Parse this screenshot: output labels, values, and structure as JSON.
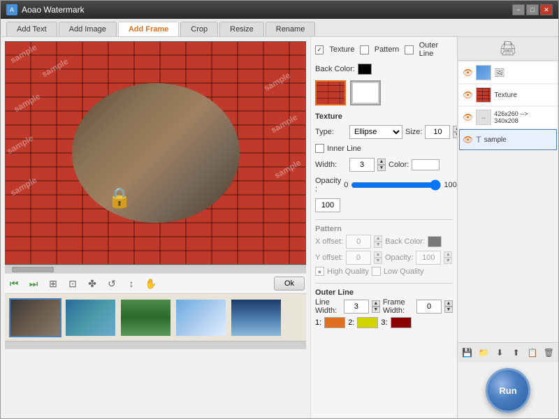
{
  "window": {
    "title": "Aoao Watermark",
    "icon": "A"
  },
  "title_controls": {
    "minimize": "−",
    "maximize": "□",
    "close": "✕"
  },
  "tabs": [
    {
      "label": "Add Text",
      "active": false
    },
    {
      "label": "Add Image",
      "active": false
    },
    {
      "label": "Add Frame",
      "active": true
    },
    {
      "label": "Crop",
      "active": false
    },
    {
      "label": "Resize",
      "active": false
    },
    {
      "label": "Rename",
      "active": false
    }
  ],
  "settings": {
    "texture_checked": true,
    "pattern_checked": false,
    "outer_line_checked": false,
    "back_color_label": "Back Color:",
    "texture_section_label": "Texture",
    "type_label": "Type:",
    "type_value": "Ellipse",
    "size_label": "Size:",
    "size_value": "10",
    "inner_line_checked": false,
    "inner_line_label": "Inner Line",
    "width_label": "Width:",
    "width_value": "3",
    "color_label": "Color:",
    "opacity_label": "Opacity :",
    "opacity_min": "0",
    "opacity_max": "100",
    "opacity_value": "100",
    "pattern_section_label": "Pattern",
    "x_offset_label": "X offset:",
    "x_offset_value": "0",
    "y_offset_label": "Y offset:",
    "y_offset_value": "0",
    "back_color2_label": "Back Color:",
    "pattern_opacity_label": "Opacity:",
    "pattern_opacity_value": "100",
    "high_quality_label": "High Quality",
    "low_quality_label": "Low Quality",
    "outer_line_label": "Outer Line",
    "line_width_label": "Line Width:",
    "line_width_value": "3",
    "frame_width_label": "Frame Width:",
    "frame_width_value": "0",
    "color1_label": "1:",
    "color2_label": "2:",
    "color3_label": "3:",
    "ok_label": "Ok"
  },
  "layers": {
    "items": [
      {
        "id": "layer-1",
        "label": "",
        "type": "image",
        "active": false
      },
      {
        "id": "layer-2",
        "label": "Texture",
        "type": "texture",
        "active": false
      },
      {
        "id": "layer-3",
        "label": "426x260 --> 340x208",
        "type": "resize",
        "active": false
      },
      {
        "id": "layer-4",
        "label": "sample",
        "type": "text",
        "active": true
      }
    ]
  },
  "thumbnails": [
    {
      "id": "thumb-1",
      "active": true
    },
    {
      "id": "thumb-2",
      "active": false
    },
    {
      "id": "thumb-3",
      "active": false
    },
    {
      "id": "thumb-4",
      "active": false
    },
    {
      "id": "thumb-5",
      "active": false
    }
  ],
  "controls": {
    "ok": "Ok",
    "run": "Run"
  }
}
